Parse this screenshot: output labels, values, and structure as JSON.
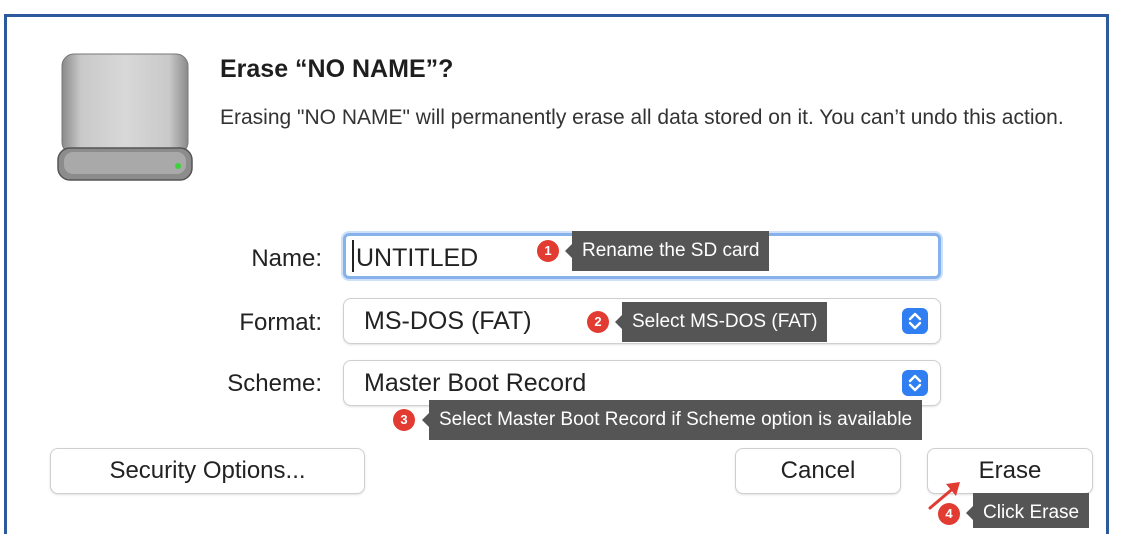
{
  "dialog": {
    "title": "Erase “NO NAME”?",
    "message": "Erasing \"NO NAME\" will permanently erase all data stored on it. You can’t undo this action.",
    "name_label": "Name:",
    "name_value": "UNTITLED",
    "format_label": "Format:",
    "format_value": "MS-DOS (FAT)",
    "scheme_label": "Scheme:",
    "scheme_value": "Master Boot Record",
    "security_button": "Security Options...",
    "cancel_button": "Cancel",
    "erase_button": "Erase"
  },
  "annotations": [
    {
      "number": "1",
      "text": "Rename the SD card"
    },
    {
      "number": "2",
      "text": "Select MS-DOS (FAT)"
    },
    {
      "number": "3",
      "text": "Select Master Boot Record if Scheme option is available"
    },
    {
      "number": "4",
      "text": "Click Erase"
    }
  ],
  "colors": {
    "frame": "#2d5a9c",
    "accent": "#2f7ff2",
    "badge": "#e23b32",
    "tooltip": "#555555",
    "focus_ring": "#86b2ec"
  },
  "icons": {
    "drive": "external-drive-icon",
    "stepper": "up-down-chevron-icon",
    "arrow": "pointer-arrow-icon"
  }
}
